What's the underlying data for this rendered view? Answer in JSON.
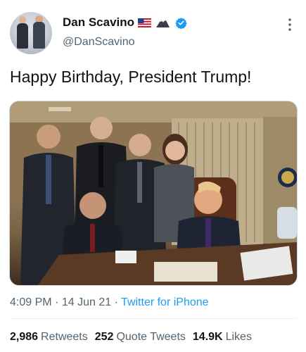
{
  "tweet": {
    "display_name": "Dan Scavino",
    "handle": "@DanScavino",
    "text": "Happy Birthday, President Trump!",
    "time": "4:09 PM",
    "date": "14 Jun 21",
    "separator": "·",
    "source": "Twitter for iPhone",
    "icons": {
      "flag": "us-flag-icon",
      "mountain": "mountain-icon",
      "verified": "verified-badge-icon",
      "more": "more-options-icon"
    },
    "colors": {
      "accent": "#1d9bf0",
      "secondary_text": "#536471",
      "primary_text": "#0f1419"
    }
  },
  "stats": {
    "retweets_count": "2,986",
    "retweets_label": "Retweets",
    "quote_count": "252",
    "quote_label": "Quote Tweets",
    "likes_count": "14.9K",
    "likes_label": "Likes"
  }
}
